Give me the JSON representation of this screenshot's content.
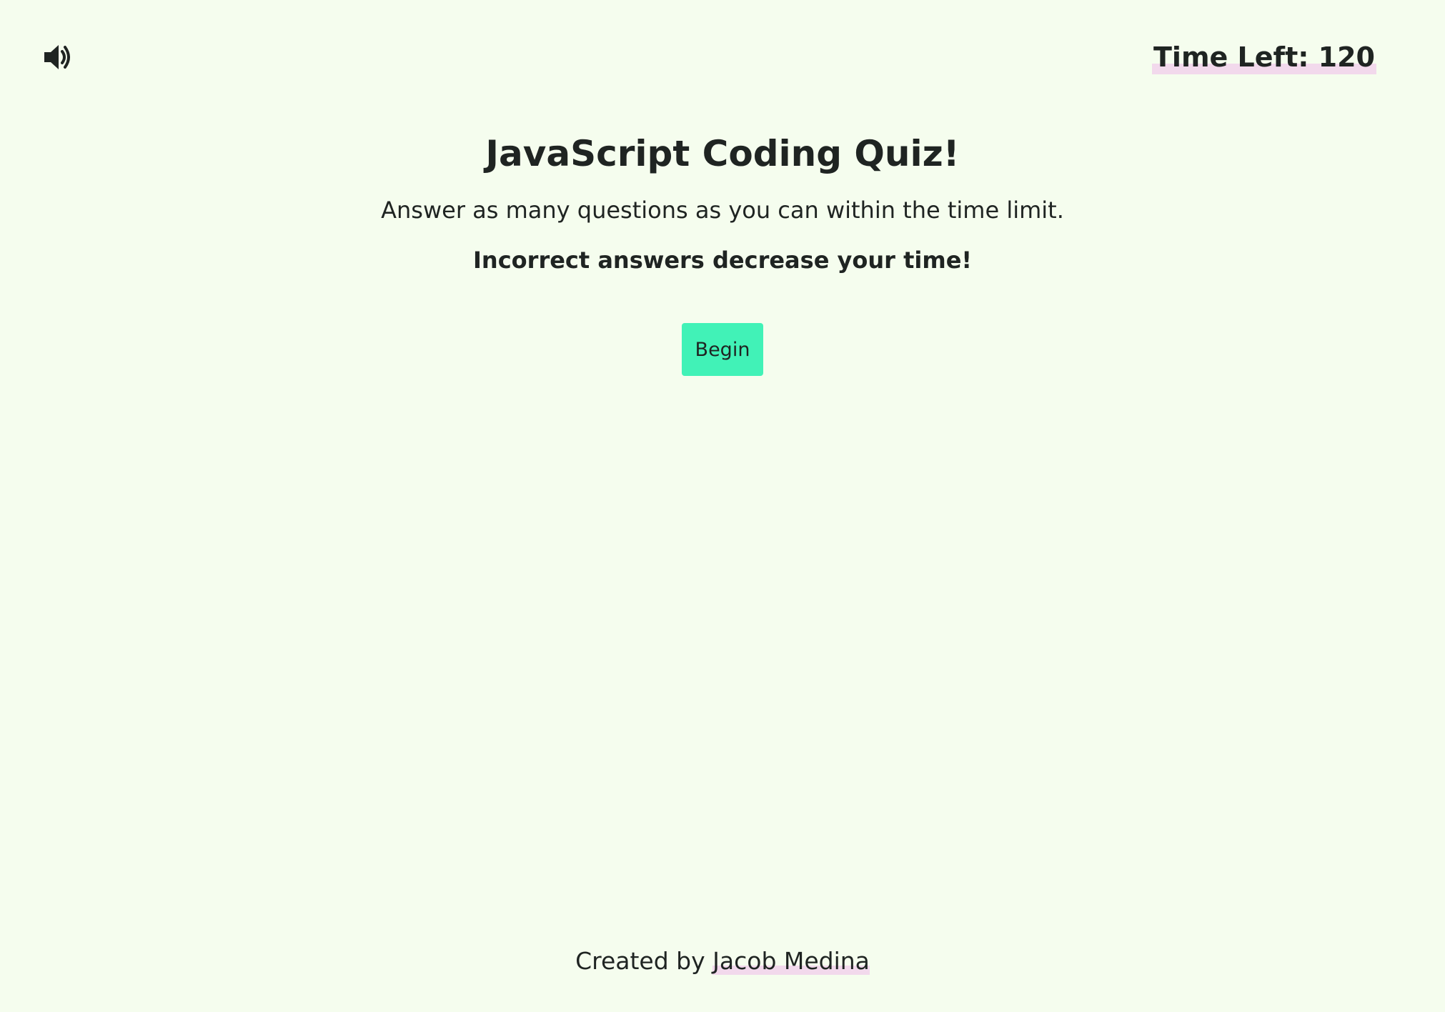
{
  "header": {
    "sound_icon": "volume-up-icon",
    "timer_label": "Time Left: 120"
  },
  "main": {
    "title": "JavaScript Coding Quiz!",
    "subtitle": "Answer as many questions as you can within the time limit.",
    "warning": "Incorrect answers decrease your time!",
    "begin_label": "Begin"
  },
  "footer": {
    "prefix": "Created by",
    "author": "Jacob Medina"
  },
  "colors": {
    "background": "#f5fdee",
    "text": "#1f2422",
    "button": "#41f2b7",
    "highlight": "#f2d9ec"
  }
}
